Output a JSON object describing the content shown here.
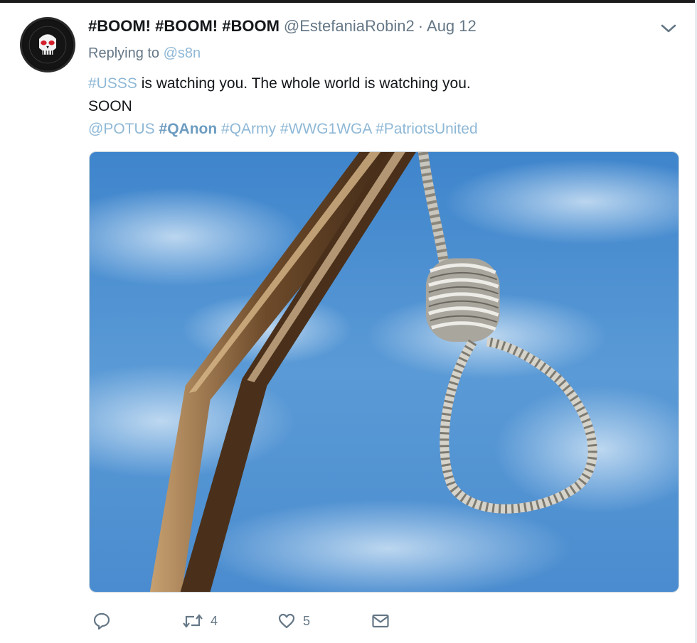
{
  "tweet": {
    "display_name": "#BOOM! #BOOM! #BOOM",
    "handle": "@EstefaniaRobin2",
    "separator": "·",
    "date": "Aug 12",
    "replying_prefix": "Replying to ",
    "replying_to": "@s8n",
    "text_hashtag": "#USSS",
    "text_rest": " is watching you. The whole world is watching you.",
    "line2": "SOON",
    "mentions": [
      "@POTUS",
      "#QAnon",
      "#QArmy",
      "#WWG1WGA",
      "#PatriotsUnited"
    ],
    "avatar_icon": "punisher-skull-avatar",
    "media_description_icon": "noose-photo",
    "counts": {
      "retweets": "4",
      "likes": "5"
    }
  },
  "icons": {
    "caret": "chevron-down-icon",
    "reply": "reply-icon",
    "retweet": "retweet-icon",
    "like": "heart-icon",
    "dm": "envelope-icon"
  },
  "colors": {
    "link": "#8fb8d6",
    "muted": "#657786",
    "text": "#14171a",
    "sky": "#4a8fd0"
  }
}
